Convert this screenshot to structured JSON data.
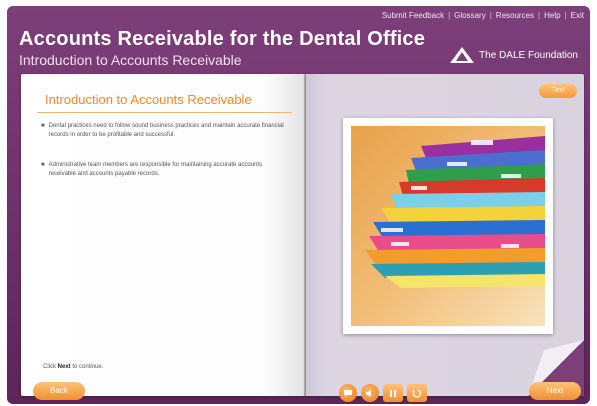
{
  "header": {
    "nav": [
      "Submit Feedback",
      "Glossary",
      "Resources",
      "Help",
      "Exit"
    ],
    "title": "Accounts Receivable for the Dental Office",
    "subtitle": "Introduction to Accounts Receivable",
    "logo_text": "The DALE Foundation"
  },
  "left_page": {
    "section_title": "Introduction to Accounts Receivable",
    "bullets": [
      "Dental practices need to follow sound business practices and maintain accurate financial records in order to be profitable and successful.",
      "Administrative team members are responsible for maintaining accurate accounts receivable and accounts payable records."
    ],
    "hint_prefix": "Click",
    "hint_bold": "Next",
    "hint_suffix": "to continue."
  },
  "right_page": {
    "transcript_label": "Text",
    "photo_subject": "stack of colored file folders"
  },
  "controls": {
    "back_label": "Back",
    "next_label": "Next",
    "icons": [
      "chat-icon",
      "audio-icon",
      "pause-icon",
      "replay-icon"
    ]
  },
  "colors": {
    "frame": "#6b2f68",
    "accent": "#f39a3c",
    "heading": "#f08a2a"
  }
}
